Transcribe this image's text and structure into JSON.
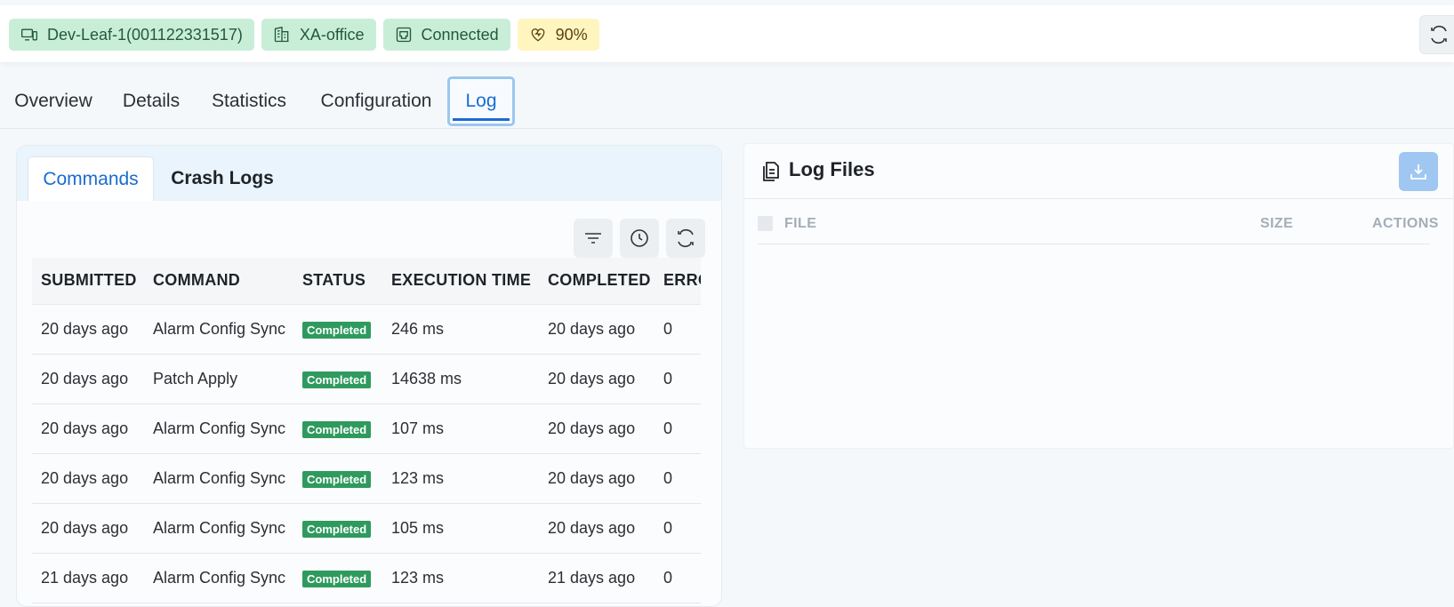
{
  "header": {
    "badges": {
      "device": "Dev-Leaf-1(001122331517)",
      "site": "XA-office",
      "connection": "Connected",
      "health": "90%"
    },
    "icons": {
      "device": "devices-icon",
      "site": "building-icon",
      "connection": "ethernet-port-icon",
      "health": "heart-pulse-icon",
      "refresh": "refresh-icon"
    }
  },
  "tabs": {
    "overview": "Overview",
    "details": "Details",
    "statistics": "Statistics",
    "configuration": "Configuration",
    "log": "Log",
    "active": "Log"
  },
  "commands_panel": {
    "subtabs": {
      "commands": "Commands",
      "crash_logs": "Crash Logs",
      "active": "Commands"
    },
    "toolbar_icons": [
      "filter-icon",
      "clock-icon",
      "refresh-icon"
    ],
    "columns": {
      "submitted": "SUBMITTED",
      "command": "COMMAND",
      "status": "STATUS",
      "execution_time": "EXECUTION TIME",
      "completed": "COMPLETED",
      "error": "ERROR"
    },
    "rows": [
      {
        "submitted": "20 days ago",
        "command": "Alarm Config Sync",
        "status": "Completed",
        "execution_time": "246 ms",
        "completed": "20 days ago",
        "error": "0"
      },
      {
        "submitted": "20 days ago",
        "command": "Patch Apply",
        "status": "Completed",
        "execution_time": "14638 ms",
        "completed": "20 days ago",
        "error": "0"
      },
      {
        "submitted": "20 days ago",
        "command": "Alarm Config Sync",
        "status": "Completed",
        "execution_time": "107 ms",
        "completed": "20 days ago",
        "error": "0"
      },
      {
        "submitted": "20 days ago",
        "command": "Alarm Config Sync",
        "status": "Completed",
        "execution_time": "123 ms",
        "completed": "20 days ago",
        "error": "0"
      },
      {
        "submitted": "20 days ago",
        "command": "Alarm Config Sync",
        "status": "Completed",
        "execution_time": "105 ms",
        "completed": "20 days ago",
        "error": "0"
      },
      {
        "submitted": "21 days ago",
        "command": "Alarm Config Sync",
        "status": "Completed",
        "execution_time": "123 ms",
        "completed": "21 days ago",
        "error": "0"
      }
    ]
  },
  "log_files": {
    "title": "Log Files",
    "columns": {
      "file": "FILE",
      "size": "SIZE",
      "actions": "ACTIONS"
    },
    "icons": {
      "title": "file-copy-icon",
      "download": "download-icon"
    }
  },
  "colors": {
    "accent": "#1a6bd1",
    "badge_green": "#c9eed8",
    "badge_yellow": "#fff5bf",
    "status_completed": "#2f9a5e",
    "download_button": "#9fc7f1"
  }
}
